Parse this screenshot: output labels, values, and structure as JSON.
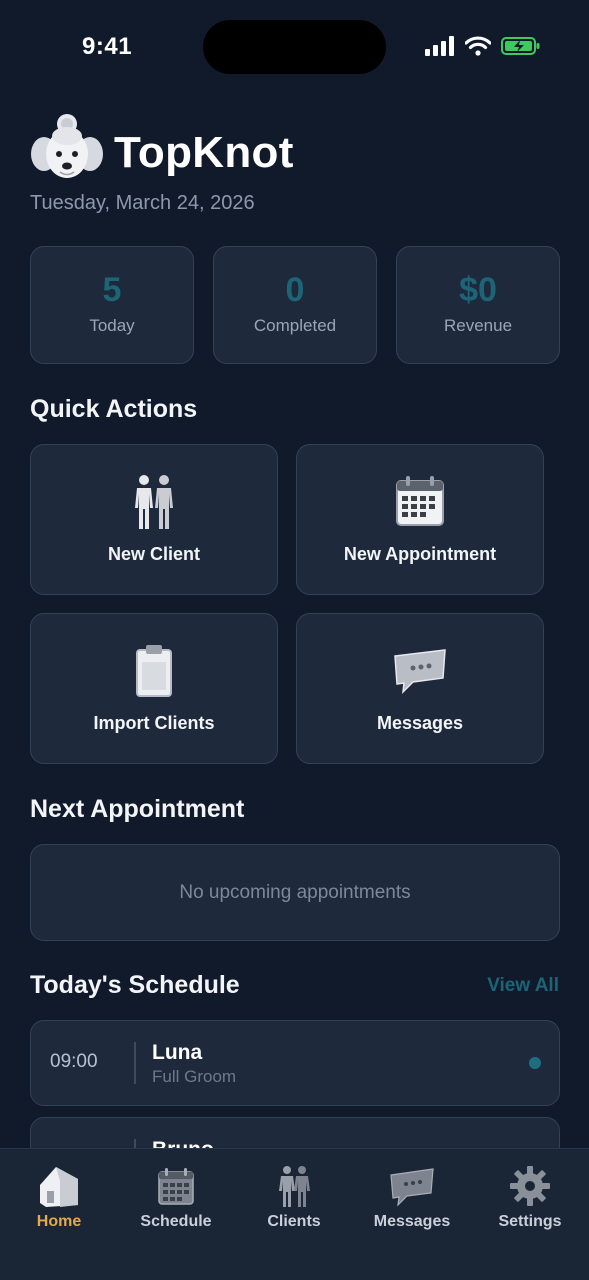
{
  "status_bar": {
    "time": "9:41"
  },
  "header": {
    "app_title": "TopKnot",
    "date": "Tuesday, March 24, 2026",
    "logo_icon": "poodle-logo-icon"
  },
  "stats": [
    {
      "value": "5",
      "label": "Today"
    },
    {
      "value": "0",
      "label": "Completed"
    },
    {
      "value": "$0",
      "label": "Revenue"
    }
  ],
  "quick_actions": {
    "title": "Quick Actions",
    "items": [
      {
        "label": "New Client",
        "icon": "people-icon"
      },
      {
        "label": "New Appointment",
        "icon": "calendar-icon"
      },
      {
        "label": "Import Clients",
        "icon": "clipboard-icon"
      },
      {
        "label": "Messages",
        "icon": "chat-bubble-icon"
      }
    ]
  },
  "next_appointment": {
    "title": "Next Appointment",
    "empty_text": "No upcoming appointments"
  },
  "schedule": {
    "title": "Today's Schedule",
    "view_all": "View All",
    "items": [
      {
        "time": "09:00",
        "name": "Luna",
        "service": "Full Groom"
      },
      {
        "time": "",
        "name": "Bruno",
        "service": ""
      }
    ]
  },
  "tab_bar": {
    "tabs": [
      {
        "label": "Home",
        "icon": "house-icon",
        "active": true
      },
      {
        "label": "Schedule",
        "icon": "calendar-icon",
        "active": false
      },
      {
        "label": "Clients",
        "icon": "people-icon",
        "active": false
      },
      {
        "label": "Messages",
        "icon": "chat-bubble-icon",
        "active": false
      },
      {
        "label": "Settings",
        "icon": "gear-icon",
        "active": false
      }
    ]
  },
  "colors": {
    "background": "#111a2b",
    "card": "#1e2a3c",
    "accent_teal": "#1d6477",
    "active_tab": "#e5a84a"
  }
}
